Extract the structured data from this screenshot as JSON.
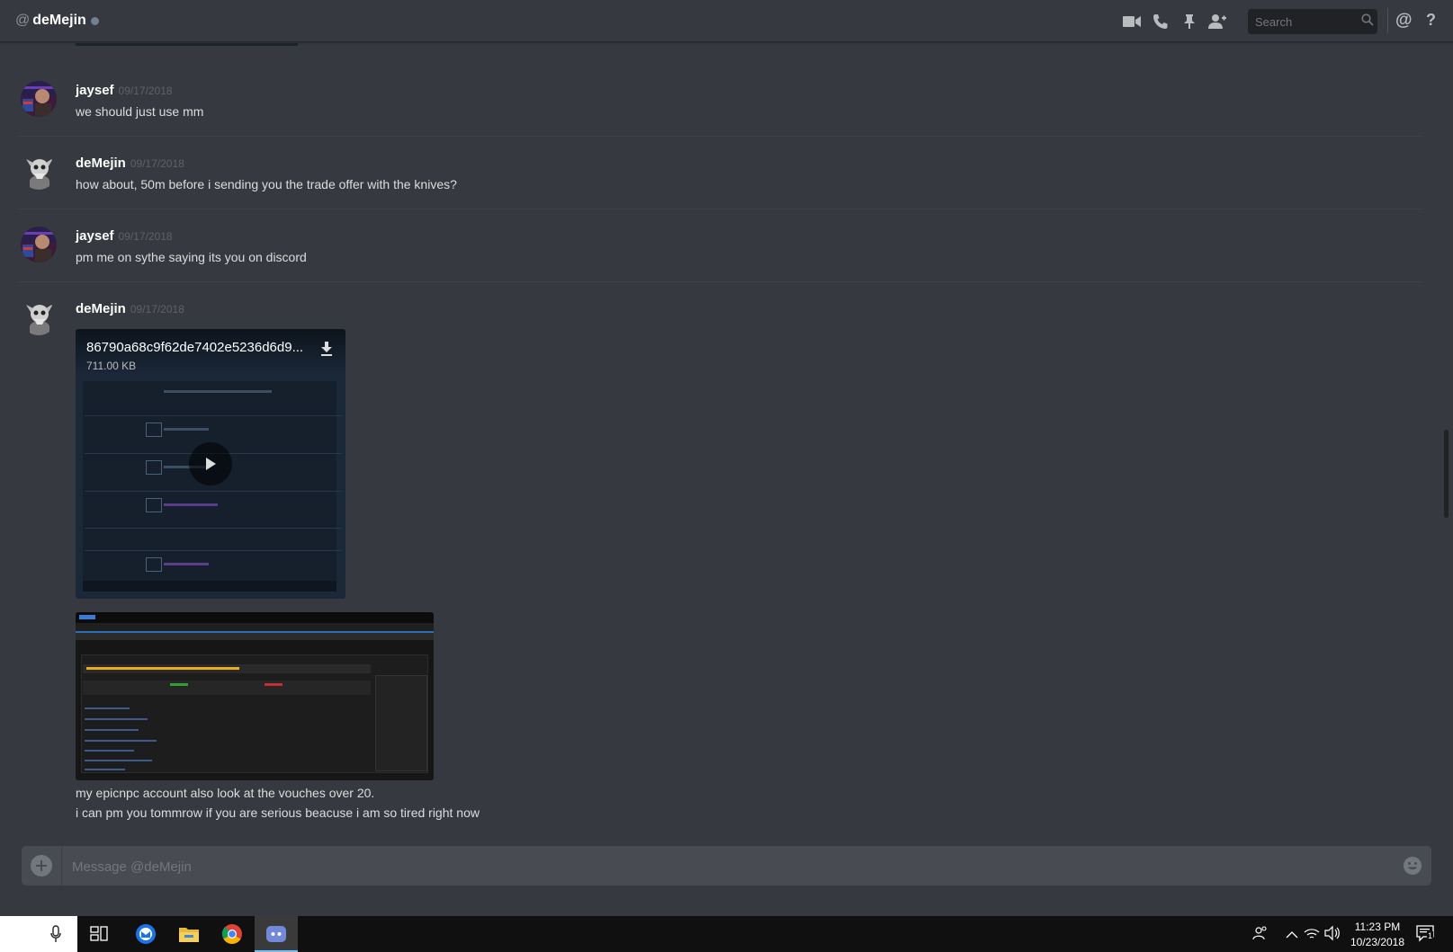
{
  "header": {
    "at_symbol": "@",
    "channel_name": "deMejin",
    "status": "offline",
    "search_placeholder": "Search",
    "mention_symbol": "@",
    "help_symbol": "?"
  },
  "messages": [
    {
      "author": "jaysef",
      "timestamp": "09/17/2018",
      "lines": [
        "we should just use mm"
      ]
    },
    {
      "author": "deMejin",
      "timestamp": "09/17/2018",
      "lines": [
        "how about, 50m before i sending you the trade offer with the knives?"
      ]
    },
    {
      "author": "jaysef",
      "timestamp": "09/17/2018",
      "lines": [
        "pm me on sythe saying its you on discord"
      ]
    },
    {
      "author": "deMejin",
      "timestamp": "09/17/2018",
      "lines": [
        "my epicnpc account also look at the vouches over 20.",
        "i can pm you tommrow if you are serious beacuse i am so tired right now"
      ]
    }
  ],
  "attachment": {
    "filename": "86790a68c9f62de7402e5236d6d9...",
    "size": "711.00 KB"
  },
  "composer": {
    "placeholder": "Message @deMejin"
  },
  "taskbar": {
    "time": "11:23 PM",
    "date": "10/23/2018",
    "notification_count": "1"
  },
  "colors": {
    "background": "#36393f",
    "header": "#36393f",
    "composer": "#484b51",
    "username": "#ffffff",
    "timestamp": "#5f6268",
    "taskbar": "#101010"
  }
}
